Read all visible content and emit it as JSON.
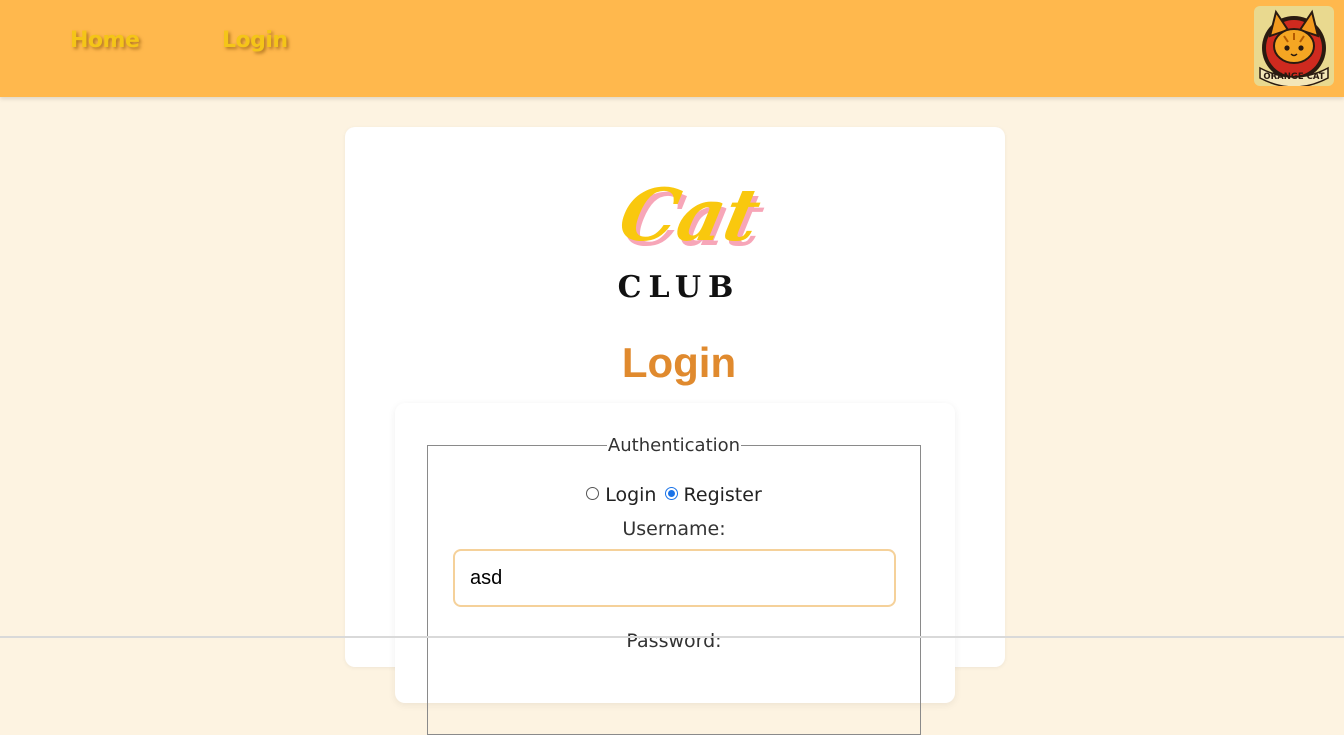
{
  "nav": {
    "home_label": "Home",
    "login_label": "Login",
    "logo_text": "ORANGE CAT"
  },
  "brand": {
    "script_word": "Cat",
    "club_word": "CLUB"
  },
  "page": {
    "title": "Login"
  },
  "form": {
    "legend": "Authentication",
    "mode_options": [
      {
        "label": "Login",
        "checked": false
      },
      {
        "label": "Register",
        "checked": true
      }
    ],
    "username_label": "Username:",
    "username_value": "asd",
    "password_label": "Password:"
  },
  "colors": {
    "navbar": "#ffb84d",
    "background": "#fdf3e1",
    "title": "#e08a2e",
    "nav_link": "#f5c518",
    "input_border": "#f5d19a"
  },
  "icons": {
    "logo": "orange-cat-badge-icon"
  }
}
